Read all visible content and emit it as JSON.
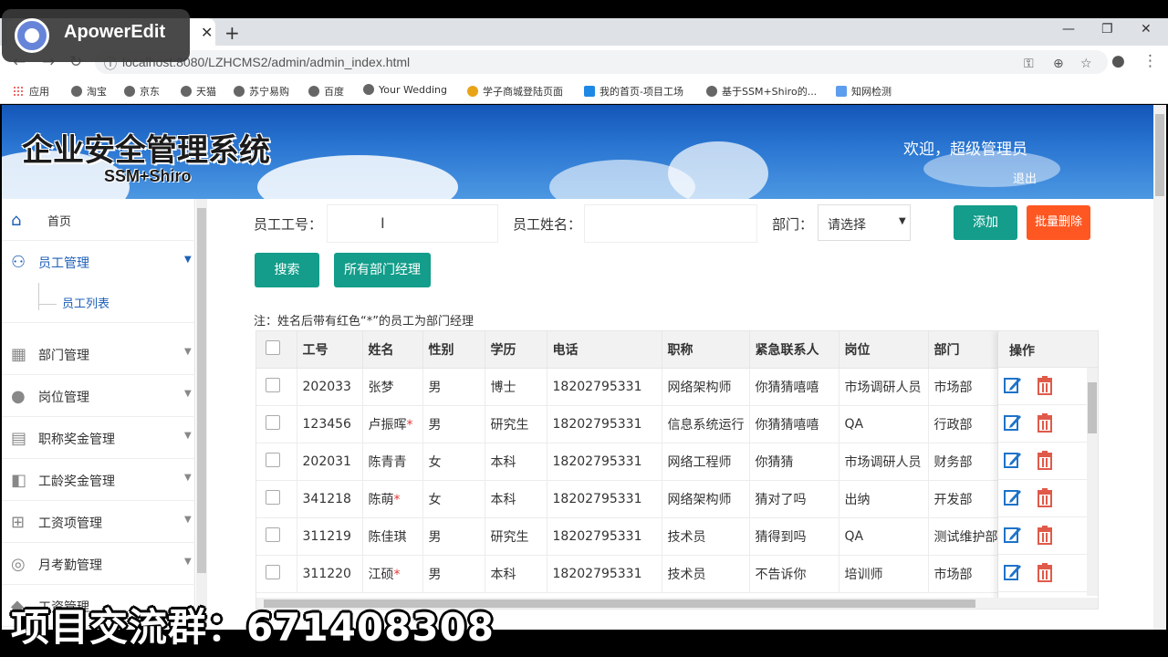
{
  "watermark": {
    "brand": "ApowerEdit"
  },
  "browser": {
    "url": "localhost:8080/LZHCMS2/admin/admin_index.html",
    "bookmarks": [
      "应用",
      "淘宝",
      "京东",
      "天猫",
      "苏宁易购",
      "百度",
      "Your Wedding",
      "学子商城登陆页面",
      "我的首页-项目工场",
      "基于SSM+Shiro的...",
      "知网检测"
    ]
  },
  "header": {
    "title": "企业安全管理系统",
    "subtitle": "SSM+Shiro",
    "welcome": "欢迎，超级管理员",
    "logout": "退出"
  },
  "sidebar": {
    "items": [
      {
        "label": "首页",
        "icon": "home-icon"
      },
      {
        "label": "员工管理",
        "icon": "users-icon"
      },
      {
        "label": "员工列表",
        "icon": ""
      },
      {
        "label": "部门管理",
        "icon": "building-icon"
      },
      {
        "label": "岗位管理",
        "icon": "person-icon"
      },
      {
        "label": "职称奖金管理",
        "icon": "certificate-icon"
      },
      {
        "label": "工龄奖金管理",
        "icon": "seniority-icon"
      },
      {
        "label": "工资项管理",
        "icon": "grid-icon"
      },
      {
        "label": "月考勤管理",
        "icon": "chat-icon"
      },
      {
        "label": "工资管理",
        "icon": "wallet-icon"
      }
    ]
  },
  "search": {
    "emp_no_label": "员工工号：",
    "emp_name_label": "员工姓名：",
    "dept_label": "部门：",
    "dept_selected": "请选择",
    "add_button": "添加",
    "batch_delete_button": "批量删除",
    "search_button": "搜索",
    "all_managers_button": "所有部门经理"
  },
  "note": "注：姓名后带有红色“*”的员工为部门经理",
  "table": {
    "headers": [
      "",
      "工号",
      "姓名",
      "性别",
      "学历",
      "电话",
      "职称",
      "紧急联系人",
      "岗位",
      "部门"
    ],
    "op_header": "操作",
    "rows": [
      {
        "id": "202033",
        "name": "张梦",
        "star": "",
        "gender": "男",
        "edu": "博士",
        "phone": "18202795331",
        "title": "网络架构师",
        "contact": "你猜猜嘻嘻",
        "post": "市场调研人员",
        "dept": "市场部"
      },
      {
        "id": "123456",
        "name": "卢振晖",
        "star": "*",
        "gender": "男",
        "edu": "研究生",
        "phone": "18202795331",
        "title": "信息系统运行",
        "contact": "你猜猜嘻嘻",
        "post": "QA",
        "dept": "行政部"
      },
      {
        "id": "202031",
        "name": "陈青青",
        "star": "",
        "gender": "女",
        "edu": "本科",
        "phone": "18202795331",
        "title": "网络工程师",
        "contact": "你猜猜",
        "post": "市场调研人员",
        "dept": "财务部"
      },
      {
        "id": "341218",
        "name": "陈萌",
        "star": "*",
        "gender": "女",
        "edu": "本科",
        "phone": "18202795331",
        "title": "网络架构师",
        "contact": "猜对了吗",
        "post": "出纳",
        "dept": "开发部"
      },
      {
        "id": "311219",
        "name": "陈佳琪",
        "star": "",
        "gender": "男",
        "edu": "研究生",
        "phone": "18202795331",
        "title": "技术员",
        "contact": "猜得到吗",
        "post": "QA",
        "dept": "测试维护部"
      },
      {
        "id": "311220",
        "name": "江硕",
        "star": "*",
        "gender": "男",
        "edu": "本科",
        "phone": "18202795331",
        "title": "技术员",
        "contact": "不告诉你",
        "post": "培训师",
        "dept": "市场部"
      }
    ]
  },
  "caption": "项目交流群：671408308",
  "colors": {
    "teal": "#139d8a",
    "orange": "#ff5722",
    "banner": "#2a76d2"
  }
}
